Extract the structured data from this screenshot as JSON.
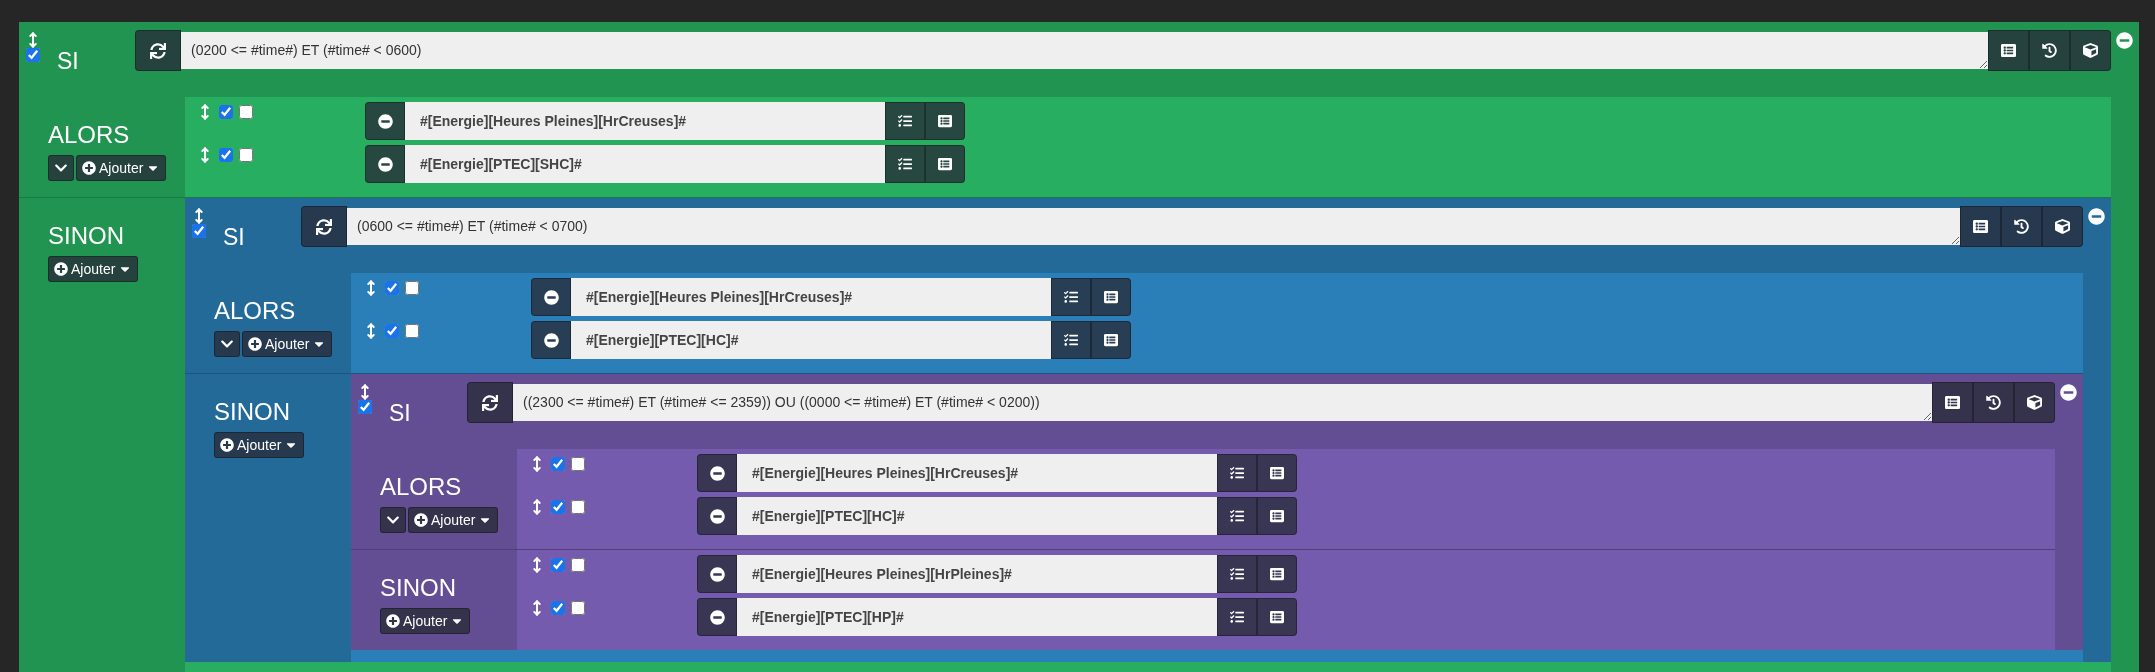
{
  "block": {
    "title": "SI",
    "enabled": true,
    "condition": "(0200 <= #time#) ET (#time# < 0600)",
    "sections": [
      {
        "label": "ALORS",
        "collapse_button": true,
        "add_button": "Ajouter",
        "items": [
          {
            "kind": "action",
            "enabled": true,
            "parallel": false,
            "expression": "#[Energie][Heures Pleines][HrCreuses]#"
          },
          {
            "kind": "action",
            "enabled": true,
            "parallel": false,
            "expression": "#[Energie][PTEC][SHC]#"
          }
        ]
      },
      {
        "label": "SINON",
        "collapse_button": false,
        "add_button": "Ajouter",
        "items": [
          {
            "kind": "block",
            "block": {
              "title": "SI",
              "enabled": true,
              "condition": "(0600 <= #time#) ET (#time# < 0700)",
              "sections": [
                {
                  "label": "ALORS",
                  "collapse_button": true,
                  "add_button": "Ajouter",
                  "items": [
                    {
                      "kind": "action",
                      "enabled": true,
                      "parallel": false,
                      "expression": "#[Energie][Heures Pleines][HrCreuses]#"
                    },
                    {
                      "kind": "action",
                      "enabled": true,
                      "parallel": false,
                      "expression": "#[Energie][PTEC][HC]#"
                    }
                  ]
                },
                {
                  "label": "SINON",
                  "collapse_button": false,
                  "add_button": "Ajouter",
                  "items": [
                    {
                      "kind": "block",
                      "block": {
                        "title": "SI",
                        "enabled": true,
                        "condition": "((2300 <= #time#) ET (#time# <= 2359)) OU ((0000 <= #time#) ET (#time# < 0200))",
                        "sections": [
                          {
                            "label": "ALORS",
                            "collapse_button": true,
                            "add_button": "Ajouter",
                            "items": [
                              {
                                "kind": "action",
                                "enabled": true,
                                "parallel": false,
                                "expression": "#[Energie][Heures Pleines][HrCreuses]#"
                              },
                              {
                                "kind": "action",
                                "enabled": true,
                                "parallel": false,
                                "expression": "#[Energie][PTEC][HC]#"
                              }
                            ]
                          },
                          {
                            "label": "SINON",
                            "collapse_button": false,
                            "add_button": "Ajouter",
                            "items": [
                              {
                                "kind": "action",
                                "enabled": true,
                                "parallel": false,
                                "expression": "#[Energie][Heures Pleines][HrPleines]#"
                              },
                              {
                                "kind": "action",
                                "enabled": true,
                                "parallel": false,
                                "expression": "#[Energie][PTEC][HP]#"
                              }
                            ]
                          }
                        ]
                      }
                    }
                  ]
                }
              ]
            }
          }
        ]
      }
    ]
  }
}
